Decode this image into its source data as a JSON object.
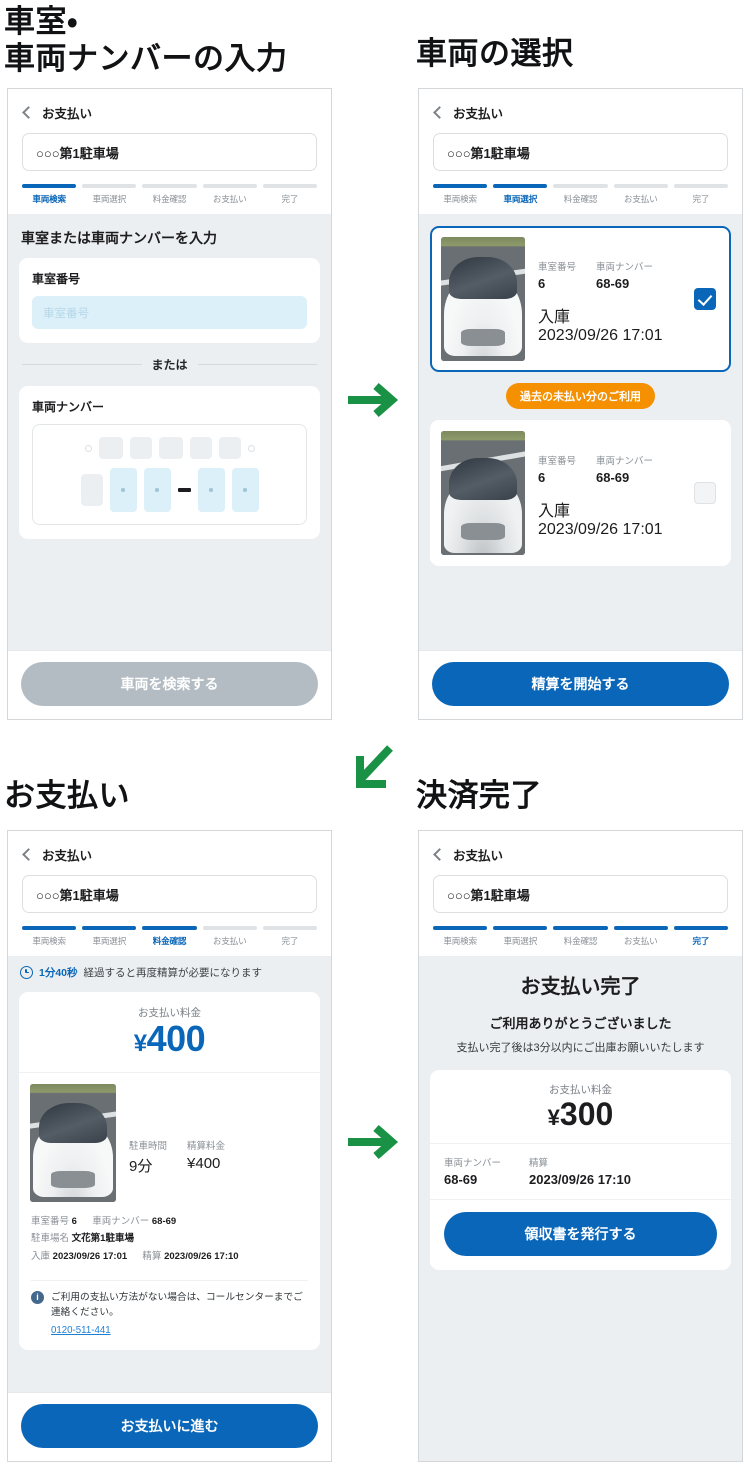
{
  "sections": {
    "s1_title": "車室・\n車両ナンバーの入力",
    "s2_title": "車両の選択",
    "s3_title": "お支払い",
    "s4_title": "決済完了"
  },
  "common": {
    "back_label": "お支払い",
    "lot_name": "○○○第1駐車場",
    "steps": [
      "車両検索",
      "車両選択",
      "料金確認",
      "お支払い",
      "完了"
    ],
    "accent_blue": "#0a66b8",
    "accent_orange": "#f59000",
    "accent_green": "#1a9245"
  },
  "panel1": {
    "heading": "車室または車両ナンバーを入力",
    "room_label": "車室番号",
    "room_placeholder": "車室番号",
    "or_text": "または",
    "plate_label": "車両ナンバー",
    "plate_dash": "—",
    "cta": "車両を検索する",
    "cta_disabled": true
  },
  "panel2": {
    "badge": "過去の未払い分のご利用",
    "cta": "精算を開始する",
    "cards": [
      {
        "selected": true,
        "room_key": "車室番号",
        "room_val": "6",
        "plate_key": "車両ナンバー",
        "plate_val": "68-69",
        "in_key": "入庫",
        "in_val": "2023/09/26 17:01"
      },
      {
        "selected": false,
        "room_key": "車室番号",
        "room_val": "6",
        "plate_key": "車両ナンバー",
        "plate_val": "68-69",
        "in_key": "入庫",
        "in_val": "2023/09/26 17:01"
      }
    ]
  },
  "panel3": {
    "notice_time": "1分40秒",
    "notice_rest": "経過すると再度精算が必要になります",
    "fee_cap": "お支払い料金",
    "fee_yen": "¥",
    "fee_amount": "400",
    "dur_key": "駐車時間",
    "dur_val": "9分",
    "calc_key": "精算料金",
    "calc_val": "¥400",
    "d_room_key": "車室番号",
    "d_room_val": "6",
    "d_plate_key": "車両ナンバー",
    "d_plate_val": "68-69",
    "d_lot_key": "駐車場名",
    "d_lot_val": "文花第1駐車場",
    "d_in_key": "入庫",
    "d_in_val": "2023/09/26 17:01",
    "d_settle_key": "精算",
    "d_settle_val": "2023/09/26 17:10",
    "info_icon": "i",
    "info_text": "ご利用の支払い方法がない場合は、コールセンターまでご連絡ください。",
    "info_tel": "0120-511-441",
    "cta": "お支払いに進む"
  },
  "panel4": {
    "done_title": "お支払い完了",
    "thanks": "ご利用ありがとうございました",
    "note": "支払い完了後は3分以内にご出庫お願いいたします",
    "fee_cap": "お支払い料金",
    "fee_yen": "¥",
    "fee_amount": "300",
    "plate_key": "車両ナンバー",
    "plate_val": "68-69",
    "settle_key": "精算",
    "settle_val": "2023/09/26 17:10",
    "cta": "領収書を発行する"
  },
  "arrows": {
    "a1": "arrow-right-icon",
    "a2": "arrow-down-left-icon",
    "a3": "arrow-right-icon"
  }
}
